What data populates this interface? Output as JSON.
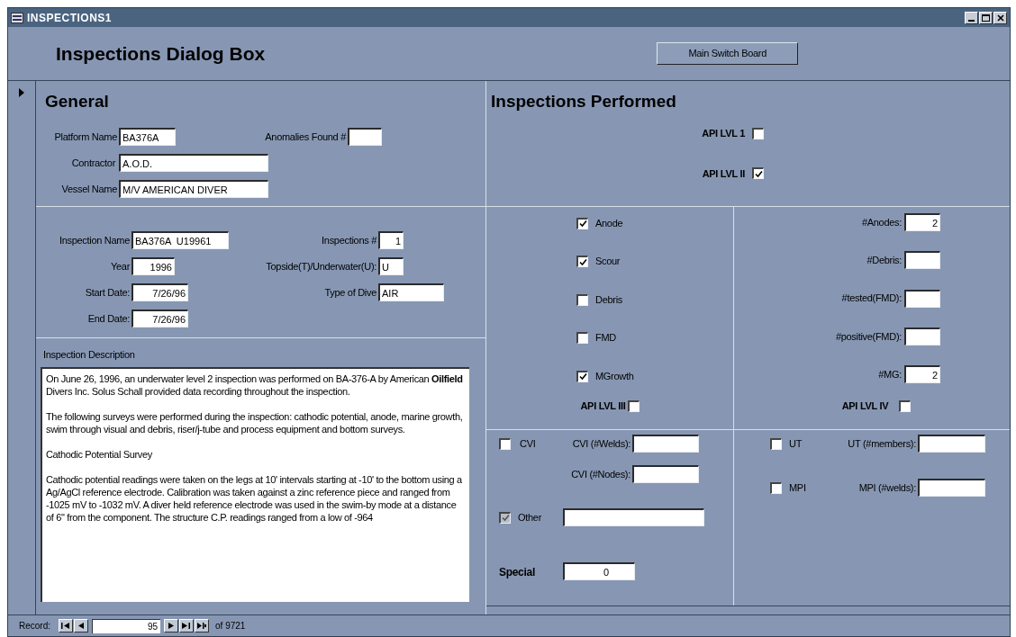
{
  "window": {
    "title": "INSPECTIONS1"
  },
  "header": {
    "title": "Inspections Dialog Box",
    "main_switch_board_button": "Main Switch Board"
  },
  "general": {
    "heading": "General",
    "platform_name": {
      "label": "Platform Name",
      "value": "BA376A"
    },
    "anomalies_found": {
      "label": "Anomalies Found #"
    },
    "contractor": {
      "label": "Contractor",
      "value": "A.O.D."
    },
    "vessel_name": {
      "label": "Vessel Name",
      "value": "M/V AMERICAN DIVER"
    }
  },
  "inspection": {
    "rows": [
      {
        "left": {
          "label": "Inspection Name",
          "value": "BA376A  U19961",
          "kind": "text"
        },
        "right": {
          "label": "Inspections #",
          "value": "1",
          "kind": "number"
        }
      },
      {
        "left": {
          "label": "Year",
          "value": "1996",
          "kind": "number"
        },
        "right": {
          "label": "Topside(T)/Underwater(U):",
          "value": "U",
          "kind": "text"
        }
      },
      {
        "left": {
          "label": "Start Date:",
          "value": "7/26/96",
          "kind": "number"
        },
        "right": {
          "label": "Type of Dive",
          "value": "AIR",
          "kind": "text"
        }
      },
      {
        "left": {
          "label": "End Date:",
          "value": "7/26/96",
          "kind": "number"
        }
      }
    ]
  },
  "description": {
    "label": "Inspection Description",
    "paragraphs": [
      "On June 26, 1996, an underwater level 2 inspection was performed on BA-376-A by American **Oilfield** Divers Inc.  Solus Schall provided data recording throughout the inspection.",
      "The following surveys were performed during the inspection:  cathodic potential, anode, marine growth, swim through visual and debris, riser/j-tube and process equipment and bottom surveys.",
      "Cathodic Potential Survey",
      "Cathodic potential readings were taken on the legs at 10' intervals starting at -10' to the bottom using a Ag/AgCl reference electrode.  Calibration was taken against a zinc reference piece and ranged from -1025 mV to -1032 mV.  A diver held reference electrode was used in the swim-by mode at a distance of 6\" from the component.  The structure C.P. readings ranged from a low of -964"
    ]
  },
  "inspections_performed": {
    "heading": "Inspections Performed",
    "api_levels": [
      {
        "label": "API LVL 1",
        "checked": false
      },
      {
        "label": "API LVL II",
        "checked": true
      }
    ],
    "surveys": [
      {
        "label": "Anode",
        "checked": true
      },
      {
        "label": "Scour",
        "checked": true
      },
      {
        "label": "Debris",
        "checked": false
      },
      {
        "label": "FMD",
        "checked": false
      },
      {
        "label": "MGrowth",
        "checked": true
      }
    ],
    "counts": [
      {
        "label": "#Anodes:",
        "value": "2"
      },
      {
        "label": "#Debris:"
      },
      {
        "label": "#tested(FMD):"
      },
      {
        "label": "#positive(FMD):"
      },
      {
        "label": "#MG:",
        "value": "2"
      }
    ],
    "api_level_iii": {
      "label": "API LVL III",
      "checked": false
    },
    "api_level_iv": {
      "label": "API LVL IV",
      "checked": false
    },
    "cvi": {
      "label": "CVI",
      "checked": false
    },
    "cvi_welds": {
      "label": "CVI (#Welds):"
    },
    "cvi_nodes": {
      "label": "CVI (#Nodes):"
    },
    "other": {
      "label": "Other",
      "checked": true,
      "disabled": true
    },
    "special": {
      "label": "Special",
      "value": "0"
    },
    "ut": {
      "label": "UT",
      "checked": false
    },
    "ut_members": {
      "label": "UT (#members):"
    },
    "mpi": {
      "label": "MPI",
      "checked": false
    },
    "mpi_welds": {
      "label": "MPI (#welds):"
    }
  },
  "navigation": {
    "label": "Record:",
    "current": "95",
    "total": "of 9721"
  }
}
